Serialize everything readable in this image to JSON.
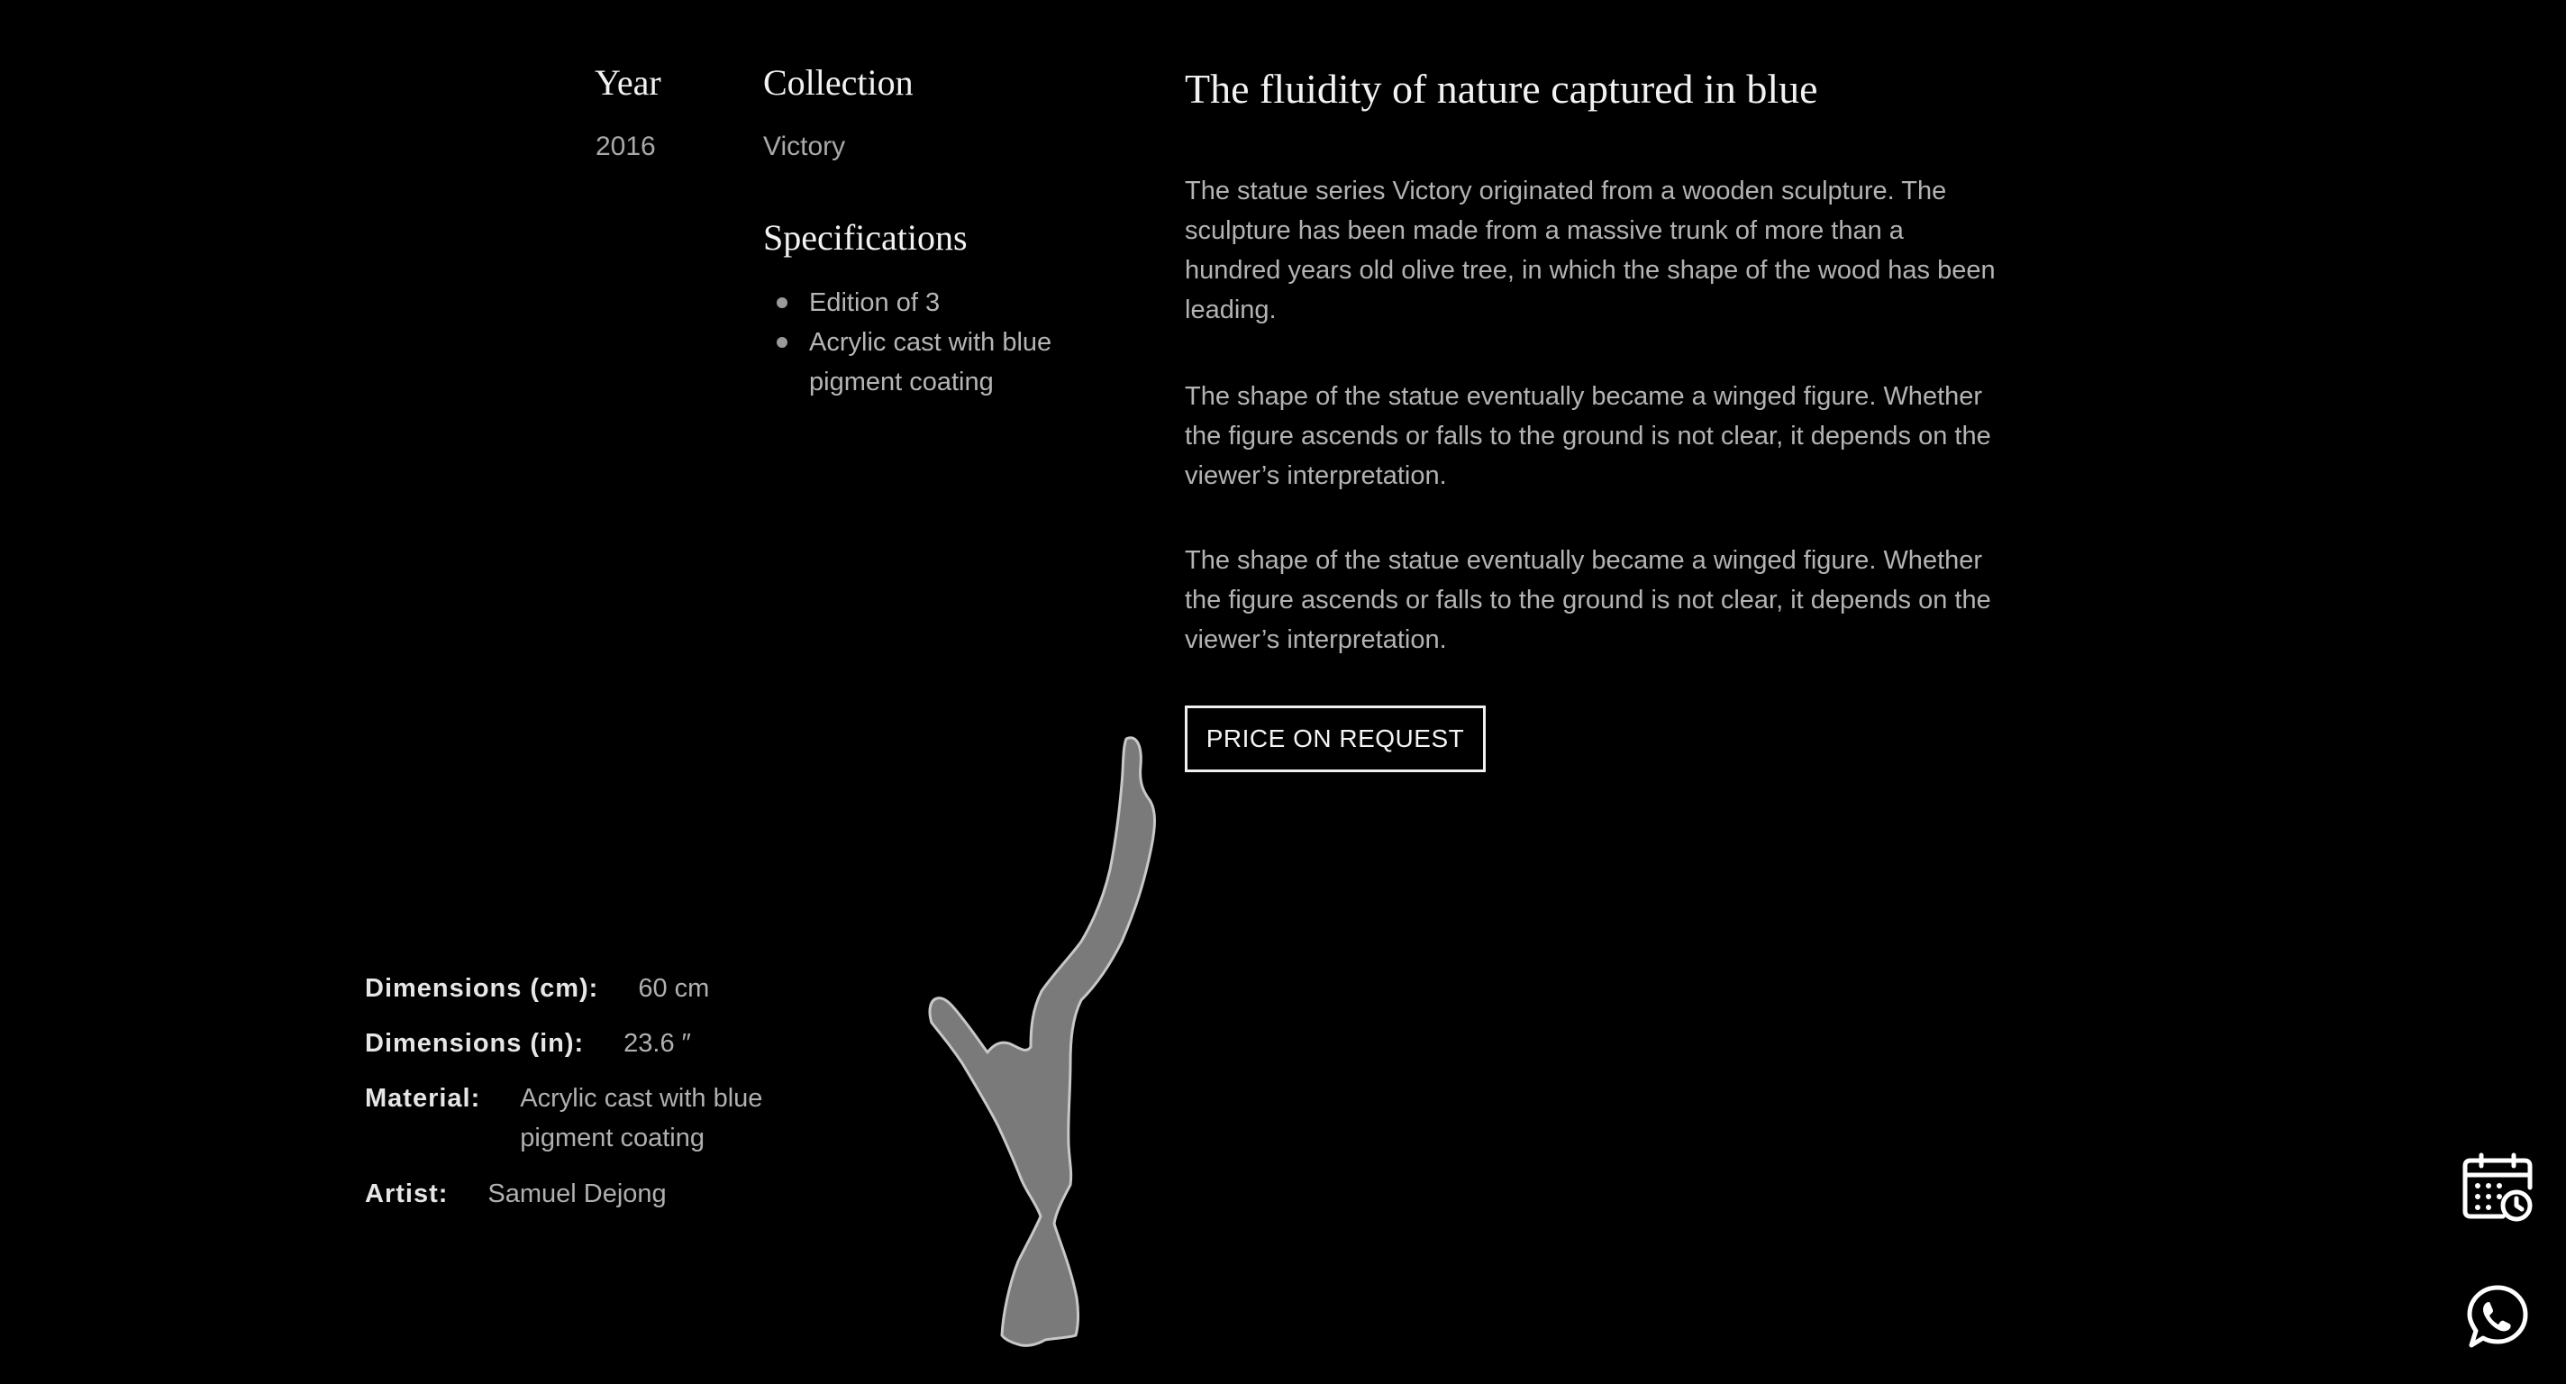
{
  "meta": {
    "year_label": "Year",
    "year_value": "2016",
    "collection_label": "Collection",
    "collection_value": "Victory",
    "specifications_label": "Specifications",
    "specifications": [
      "Edition of 3",
      "Acrylic cast with blue pigment coating"
    ]
  },
  "article": {
    "title": "The fluidity of nature captured in blue",
    "paragraphs": [
      "The statue series Victory originated from a wooden sculpture. The sculpture has been made from a massive trunk of more than a hundred years old olive tree, in which the shape of the wood has been leading.",
      "The shape of the statue eventually became a winged figure. Whether the figure ascends or falls to the ground is not clear, it depends on the viewer’s interpretation.",
      "The shape of the statue eventually became a winged figure. Whether the figure ascends or falls to the ground is not clear, it depends on the viewer’s interpretation."
    ],
    "cta_label": "PRICE ON REQUEST"
  },
  "details": {
    "dimensions_cm_label": "Dimensions (cm):",
    "dimensions_cm_value": "60 cm",
    "dimensions_in_label": "Dimensions (in):",
    "dimensions_in_value": "23.6 ″",
    "material_label": "Material:",
    "material_value_line1": "Acrylic cast with blue",
    "material_value_line2": "pigment coating",
    "artist_label": "Artist:",
    "artist_value": "Samuel Dejong"
  },
  "floating_actions": {
    "calendar_icon": "calendar-clock-icon",
    "whatsapp_icon": "whatsapp-icon"
  },
  "colors": {
    "background": "#000000",
    "sculpture_fill": "#7a7a7a",
    "sculpture_stroke": "#c8c8c8"
  }
}
